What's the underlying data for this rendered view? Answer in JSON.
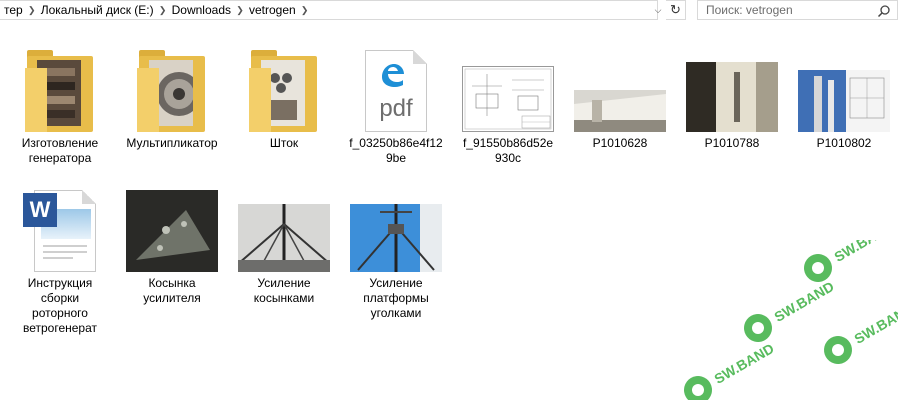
{
  "breadcrumb": {
    "items": [
      "тер",
      "Локальный диск (E:)",
      "Downloads",
      "vetrogen"
    ]
  },
  "search": {
    "placeholder": "Поиск: vetrogen"
  },
  "files": [
    {
      "name": "Изготовление генератора",
      "type": "folder"
    },
    {
      "name": "Мультипликатор",
      "type": "folder"
    },
    {
      "name": "Шток",
      "type": "folder"
    },
    {
      "name": "f_03250b86e4f129be",
      "type": "pdf",
      "icon_text": "pdf"
    },
    {
      "name": "f_91550b86d52e930c",
      "type": "drawing"
    },
    {
      "name": "P1010628",
      "type": "image"
    },
    {
      "name": "P1010788",
      "type": "image"
    },
    {
      "name": "P1010802",
      "type": "image"
    },
    {
      "name": "Инструкция сборки роторного ветрогенерат",
      "type": "word",
      "icon_text": "W"
    },
    {
      "name": "Косынка усилителя",
      "type": "image"
    },
    {
      "name": "Усиление косынками",
      "type": "image"
    },
    {
      "name": "Усиление платформы уголками",
      "type": "image"
    }
  ],
  "watermark": {
    "text": "SW.BAND"
  },
  "colors": {
    "folder": "#e8bd4a",
    "pdf_accent": "#1e8fd6",
    "word_accent": "#2b579a",
    "watermark": "#3cb043"
  }
}
